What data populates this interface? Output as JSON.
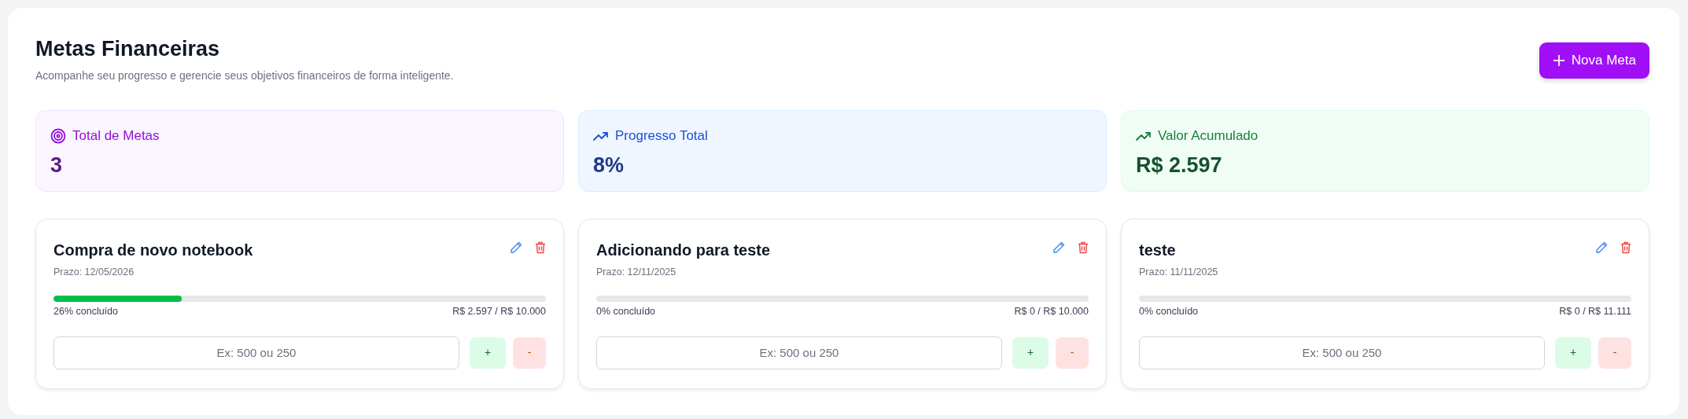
{
  "header": {
    "title": "Metas Financeiras",
    "subtitle": "Acompanhe seu progresso e gerencie seus objetivos financeiros de forma inteligente.",
    "new_button": "Nova Meta"
  },
  "stats": [
    {
      "kind": "count",
      "label": "Total de Metas",
      "value": "3"
    },
    {
      "kind": "progress",
      "label": "Progresso Total",
      "value": "8%"
    },
    {
      "kind": "amount",
      "label": "Valor Acumulado",
      "value": "R$ 2.597"
    }
  ],
  "goals": [
    {
      "title": "Compra de novo notebook",
      "deadline": "Prazo: 12/05/2026",
      "level": 0.26,
      "progress_text": "26% concluído",
      "amount": "R$ 2.597 / R$ 10.000",
      "placeholder": "Ex: 500 ou 250",
      "add": "+",
      "subtract": "-"
    },
    {
      "title": "Adicionando para teste",
      "deadline": "Prazo: 12/11/2025",
      "level": 0,
      "progress_text": "0% concluído",
      "amount": "R$ 0 / R$ 10.000",
      "placeholder": "Ex: 500 ou 250",
      "add": "+",
      "subtract": "-"
    },
    {
      "title": "teste",
      "deadline": "Prazo: 11/11/2025",
      "level": 0,
      "progress_text": "0% concluído",
      "amount": "R$ 0 / R$ 11.111",
      "placeholder": "Ex: 500 ou 250",
      "add": "+",
      "subtract": "-"
    }
  ]
}
